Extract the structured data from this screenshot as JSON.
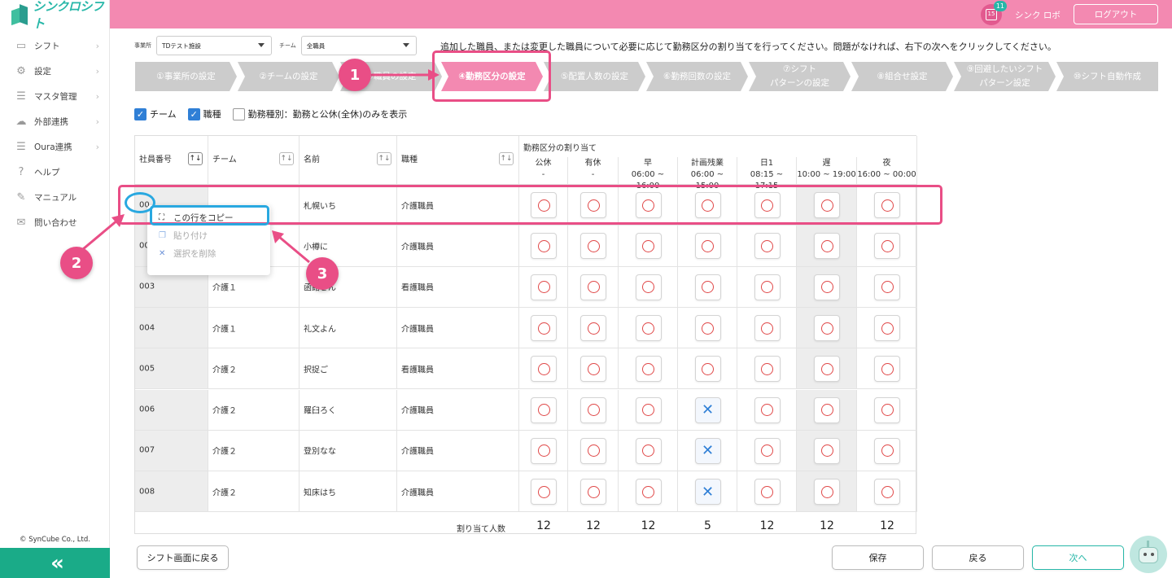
{
  "app": {
    "brand": "シンクロシフト",
    "user_name": "シンク ロボ",
    "logout_label": "ログアウト",
    "notification_count": "11",
    "calendar_day": "15"
  },
  "sidebar": {
    "items": [
      {
        "label": "シフト",
        "icon": "calendar-icon"
      },
      {
        "label": "設定",
        "icon": "gear-icon"
      },
      {
        "label": "マスタ管理",
        "icon": "database-icon"
      },
      {
        "label": "外部連携",
        "icon": "cloud-icon"
      },
      {
        "label": "Oura連携",
        "icon": "database-icon"
      },
      {
        "label": "ヘルプ",
        "icon": "help-icon"
      },
      {
        "label": "マニュアル",
        "icon": "pencil-icon"
      },
      {
        "label": "問い合わせ",
        "icon": "mail-icon"
      }
    ],
    "copyright": "© SynCube Co., Ltd.",
    "collapse_glyph": "«"
  },
  "filters": {
    "office_label": "事業所",
    "office_value": "TDテスト施設",
    "team_label": "チーム",
    "team_value": "全職員"
  },
  "notice": "追加した職員、または変更した職員について必要に応じて勤務区分の割り当てを行ってください。問題がなければ、右下の次へをクリックしてください。",
  "steps": [
    {
      "label": "①事業所の設定"
    },
    {
      "label": "②チームの設定"
    },
    {
      "label": "③職員の設定"
    },
    {
      "label": "④勤務区分の設定",
      "active": true
    },
    {
      "label": "⑤配置人数の設定"
    },
    {
      "label": "⑥勤務回数の設定"
    },
    {
      "label": "⑦シフト\nパターンの設定"
    },
    {
      "label": "⑧組合せ設定"
    },
    {
      "label": "⑨回避したいシフト\nパターン設定"
    },
    {
      "label": "⑩シフト自動作成"
    }
  ],
  "checkboxes": [
    {
      "label": "チーム",
      "checked": true
    },
    {
      "label": "職種",
      "checked": true
    },
    {
      "label": "勤務種別：勤務と公休(全休)のみを表示",
      "checked": false
    }
  ],
  "table": {
    "headers": {
      "id": "社員番号",
      "team": "チーム",
      "name": "名前",
      "job": "職種",
      "group": "勤務区分の割り当て"
    },
    "shifts": [
      {
        "name": "公休",
        "time": "-"
      },
      {
        "name": "有休",
        "time": "-"
      },
      {
        "name": "早",
        "time": "06:00 ~ 16:00"
      },
      {
        "name": "計画残業",
        "time": "06:00 ~ 15:00"
      },
      {
        "name": "日1",
        "time": "08:15 ~ 17:15"
      },
      {
        "name": "遅",
        "time": "10:00 ~ 19:00"
      },
      {
        "name": "夜",
        "time": "16:00 ~ 00:00"
      }
    ],
    "rows": [
      {
        "id": "00",
        "team": "",
        "name": "札幌いち",
        "job": "介護職員",
        "marks": [
          "o",
          "o",
          "o",
          "o",
          "o",
          "o",
          "o"
        ]
      },
      {
        "id": "00",
        "team": "",
        "name": "小樽に",
        "job": "介護職員",
        "marks": [
          "o",
          "o",
          "o",
          "o",
          "o",
          "o",
          "o"
        ]
      },
      {
        "id": "003",
        "team": "介護１",
        "name": "函館さん",
        "job": "看護職員",
        "marks": [
          "o",
          "o",
          "o",
          "o",
          "o",
          "o",
          "o"
        ]
      },
      {
        "id": "004",
        "team": "介護１",
        "name": "礼文よん",
        "job": "介護職員",
        "marks": [
          "o",
          "o",
          "o",
          "o",
          "o",
          "o",
          "o"
        ]
      },
      {
        "id": "005",
        "team": "介護２",
        "name": "択捉ご",
        "job": "看護職員",
        "marks": [
          "o",
          "o",
          "o",
          "o",
          "o",
          "o",
          "o"
        ]
      },
      {
        "id": "006",
        "team": "介護２",
        "name": "羅臼ろく",
        "job": "介護職員",
        "marks": [
          "o",
          "o",
          "o",
          "x",
          "o",
          "o",
          "o"
        ]
      },
      {
        "id": "007",
        "team": "介護２",
        "name": "登別なな",
        "job": "介護職員",
        "marks": [
          "o",
          "o",
          "o",
          "x",
          "o",
          "o",
          "o"
        ]
      },
      {
        "id": "008",
        "team": "介護２",
        "name": "知床はち",
        "job": "介護職員",
        "marks": [
          "o",
          "o",
          "o",
          "x",
          "o",
          "o",
          "o"
        ]
      }
    ],
    "totals_label": "割り当て人数",
    "totals": [
      "12",
      "12",
      "12",
      "5",
      "12",
      "12",
      "12"
    ]
  },
  "context_menu": {
    "copy_row": "この行をコピー",
    "paste": "貼り付け",
    "delete_selection": "選択を削除"
  },
  "annotations": {
    "n1": "1",
    "n2": "2",
    "n3": "3"
  },
  "buttons": {
    "back_to_shift": "シフト画面に戻る",
    "save": "保存",
    "back": "戻る",
    "next": "次へ"
  },
  "colors": {
    "header_pink": "#f389b1",
    "accent_teal": "#27b7a8",
    "annotation_pink": "#e94e86",
    "annotation_blue": "#29a8e0",
    "check_blue": "#2f7fd6",
    "circle_red": "#e04848"
  }
}
